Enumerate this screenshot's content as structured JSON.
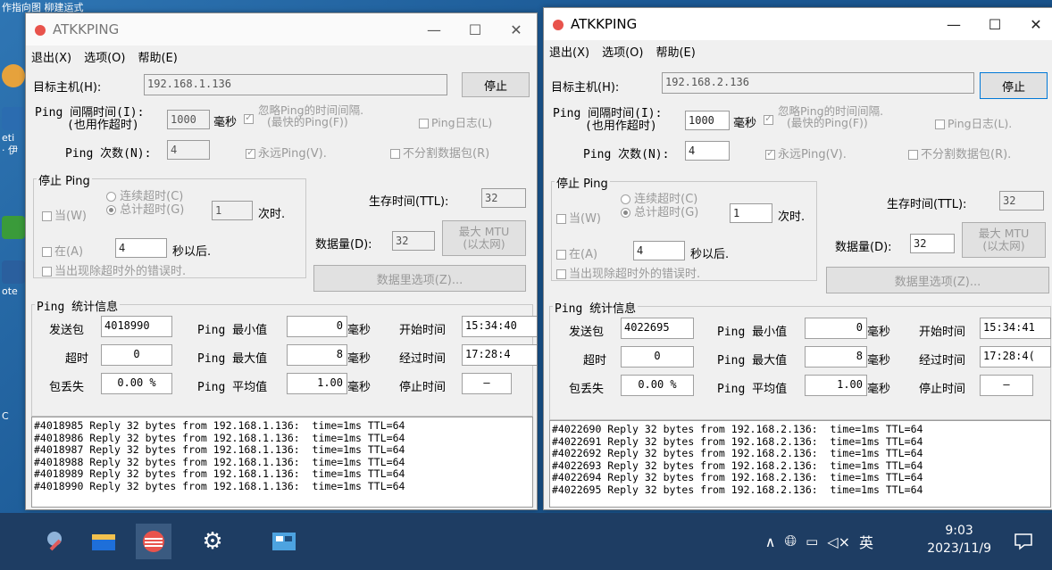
{
  "desktop": {
    "strip_text": "作指向图 柳建运式",
    "icon_labels": [
      "eti",
      "· 伊",
      "ote",
      "C"
    ]
  },
  "windows": [
    {
      "title": "ATKKPING",
      "menu": [
        "退出(X)",
        "选项(O)",
        "帮助(E)"
      ],
      "target_label": "目标主机(H):",
      "target_value": "192.168.1.136",
      "stop_button": "停止",
      "interval_label_1": "Ping 间隔时间(I):",
      "interval_label_2": "(也用作超时)",
      "interval_value": "1000",
      "interval_unit": "毫秒",
      "ignore_interval_1": "忽略Ping的时间间隔.",
      "ignore_interval_2": "(最快的Ping(F))",
      "ping_log": "Ping日志(L)",
      "count_label": "Ping 次数(N):",
      "count_value": "4",
      "forever": "永远Ping(V).",
      "no_fragment": "不分割数据包(R)",
      "stop_group": "停止 Ping",
      "when": "当(W)",
      "consecutive": "连续超时(C)",
      "total": "总计超时(G)",
      "timeout_value": "1",
      "times_suffix": "次时.",
      "in": "在(A)",
      "in_value": "4",
      "seconds_after": "秒以后.",
      "when_error": "当出现除超时外的错误时.",
      "ttl_label": "生存时间(TTL):",
      "ttl_value": "32",
      "data_label": "数据量(D):",
      "data_value": "32",
      "max_mtu_1": "最大 MTU",
      "max_mtu_2": "(以太网)",
      "data_options": "数据里选项(Z)...",
      "stats_group": "Ping  统计信息",
      "sent_label": "发送包",
      "sent_value": "4018990",
      "min_label": "Ping 最小值",
      "min_value": "0",
      "ms": "毫秒",
      "start_label": "开始时间",
      "start_value": "15:34:40",
      "timeout_label": "超时",
      "timeout_count": "0",
      "max_label": "Ping 最大值",
      "max_value": "8",
      "elapsed_label": "经过时间",
      "elapsed_value": "17:28:4",
      "loss_label": "包丢失",
      "loss_value": "0.00 %",
      "avg_label": "Ping 平均值",
      "avg_value": "1.00",
      "stop_time_label": "停止时间",
      "stop_time_value": "—",
      "log": [
        "#4018985 Reply 32 bytes from 192.168.1.136:  time=1ms TTL=64",
        "#4018986 Reply 32 bytes from 192.168.1.136:  time=1ms TTL=64",
        "#4018987 Reply 32 bytes from 192.168.1.136:  time=1ms TTL=64",
        "#4018988 Reply 32 bytes from 192.168.1.136:  time=1ms TTL=64",
        "#4018989 Reply 32 bytes from 192.168.1.136:  time=1ms TTL=64",
        "#4018990 Reply 32 bytes from 192.168.1.136:  time=1ms TTL=64"
      ]
    },
    {
      "title": "ATKKPING",
      "menu": [
        "退出(X)",
        "选项(O)",
        "帮助(E)"
      ],
      "target_label": "目标主机(H):",
      "target_value": "192.168.2.136",
      "stop_button": "停止",
      "interval_label_1": "Ping 间隔时间(I):",
      "interval_label_2": "(也用作超时)",
      "interval_value": "1000",
      "interval_unit": "毫秒",
      "ignore_interval_1": "忽略Ping的时间间隔.",
      "ignore_interval_2": "(最快的Ping(F))",
      "ping_log": "Ping日志(L).",
      "count_label": "Ping 次数(N):",
      "count_value": "4",
      "forever": "永远Ping(V).",
      "no_fragment": "不分割数据包(R).",
      "stop_group": "停止 Ping",
      "when": "当(W)",
      "consecutive": "连续超时(C)",
      "total": "总计超时(G)",
      "timeout_value": "1",
      "times_suffix": "次时.",
      "in": "在(A)",
      "in_value": "4",
      "seconds_after": "秒以后.",
      "when_error": "当出现除超时外的错误时.",
      "ttl_label": "生存时间(TTL):",
      "ttl_value": "32",
      "data_label": "数据量(D):",
      "data_value": "32",
      "max_mtu_1": "最大 MTU",
      "max_mtu_2": "(以太网)",
      "data_options": "数据里选项(Z)...",
      "stats_group": "Ping  统计信息",
      "sent_label": "发送包",
      "sent_value": "4022695",
      "min_label": "Ping 最小值",
      "min_value": "0",
      "ms": "毫秒",
      "start_label": "开始时间",
      "start_value": "15:34:41",
      "timeout_label": "超时",
      "timeout_count": "0",
      "max_label": "Ping 最大值",
      "max_value": "8",
      "elapsed_label": "经过时间",
      "elapsed_value": "17:28:4(",
      "loss_label": "包丢失",
      "loss_value": "0.00 %",
      "avg_label": "Ping 平均值",
      "avg_value": "1.00",
      "stop_time_label": "停止时间",
      "stop_time_value": "—",
      "log": [
        "#4022690 Reply 32 bytes from 192.168.2.136:  time=1ms TTL=64",
        "#4022691 Reply 32 bytes from 192.168.2.136:  time=1ms TTL=64",
        "#4022692 Reply 32 bytes from 192.168.2.136:  time=1ms TTL=64",
        "#4022693 Reply 32 bytes from 192.168.2.136:  time=1ms TTL=64",
        "#4022694 Reply 32 bytes from 192.168.2.136:  time=1ms TTL=64",
        "#4022695 Reply 32 bytes from 192.168.2.136:  time=1ms TTL=64"
      ]
    }
  ],
  "taskbar": {
    "apps": [
      "settings-app-icon",
      "file-explorer-icon",
      "atkkping-icon",
      "gear-icon",
      "network-tool-icon"
    ],
    "tray": {
      "up_arrow": "∧",
      "lang": "英",
      "time": "9:03",
      "date": "2023/11/9"
    },
    "colors": {
      "taskbar": "#1e3d63",
      "accent": "#e8534c"
    }
  }
}
